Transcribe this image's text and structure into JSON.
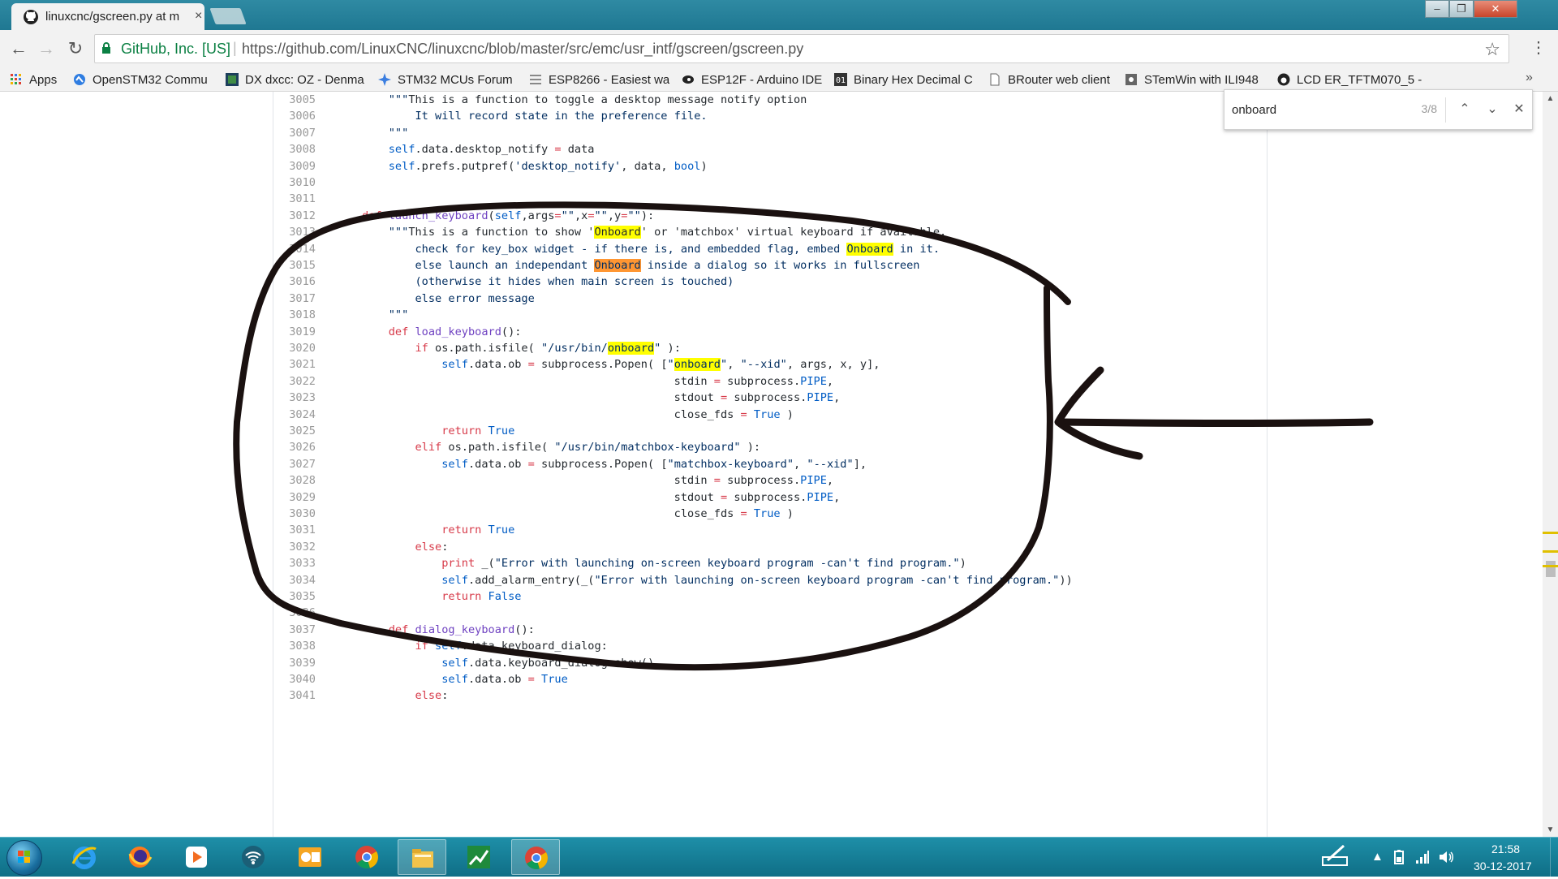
{
  "browser": {
    "tab_title": "linuxcnc/gscreen.py at m",
    "tab_close": "×",
    "window_controls": {
      "minimize": "–",
      "restore": "❐",
      "close": "✕"
    }
  },
  "toolbar": {
    "back": "←",
    "forward": "→",
    "reload": "↻",
    "ev_label": "GitHub, Inc. [US]",
    "separator": "|",
    "url": "https://github.com/LinuxCNC/linuxcnc/blob/master/src/emc/usr_intf/gscreen/gscreen.py",
    "star": "☆",
    "menu": "⋮"
  },
  "bookmarks": {
    "items": [
      {
        "label": "Apps",
        "icon": "apps-grid-icon"
      },
      {
        "label": "OpenSTM32 Commu",
        "icon": "openstm32-icon"
      },
      {
        "label": "DX dxcc: OZ - Denma",
        "icon": "dx-icon"
      },
      {
        "label": "STM32 MCUs Forum",
        "icon": "st-star-icon"
      },
      {
        "label": "ESP8266 - Easiest wa",
        "icon": "instructables-icon"
      },
      {
        "label": "ESP12F - Arduino IDE",
        "icon": "eye-icon"
      },
      {
        "label": "Binary Hex Decimal C",
        "icon": "binary-icon"
      },
      {
        "label": "BRouter web client",
        "icon": "page-icon"
      },
      {
        "label": "STemWin with ILI948",
        "icon": "gear-page-icon"
      },
      {
        "label": "LCD ER_TFTM070_5 -",
        "icon": "github-icon"
      }
    ],
    "more": "»"
  },
  "find": {
    "query": "onboard",
    "count": "3/8",
    "prev": "⌃",
    "next": "⌄",
    "close": "✕"
  },
  "code": {
    "lines": [
      {
        "n": "3005",
        "t": "        \"\"\"This is a function to toggle a desktop message notify option"
      },
      {
        "n": "3006",
        "t": "            It will record state in the preference file."
      },
      {
        "n": "3007",
        "t": "        \"\"\""
      },
      {
        "n": "3008",
        "t": "        self.data.desktop_notify = data"
      },
      {
        "n": "3009",
        "t": "        self.prefs.putpref('desktop_notify', data, bool)"
      },
      {
        "n": "3010",
        "t": ""
      },
      {
        "n": "3011",
        "t": ""
      },
      {
        "n": "3012",
        "t": "    def launch_keyboard(self,args=\"\",x=\"\",y=\"\"):"
      },
      {
        "n": "3013",
        "t": "        \"\"\"This is a function to show 'Onboard' or 'matchbox' virtual keyboard if available."
      },
      {
        "n": "3014",
        "t": "            check for key_box widget - if there is, and embedded flag, embed Onboard in it."
      },
      {
        "n": "3015",
        "t": "            else launch an independant Onboard inside a dialog so it works in fullscreen"
      },
      {
        "n": "3016",
        "t": "            (otherwise it hides when main screen is touched)"
      },
      {
        "n": "3017",
        "t": "            else error message"
      },
      {
        "n": "3018",
        "t": "        \"\"\""
      },
      {
        "n": "3019",
        "t": "        def load_keyboard():"
      },
      {
        "n": "3020",
        "t": "            if os.path.isfile( \"/usr/bin/onboard\" ):"
      },
      {
        "n": "3021",
        "t": "                self.data.ob = subprocess.Popen( [\"onboard\", \"--xid\", args, x, y],"
      },
      {
        "n": "3022",
        "t": "                                                   stdin = subprocess.PIPE,"
      },
      {
        "n": "3023",
        "t": "                                                   stdout = subprocess.PIPE,"
      },
      {
        "n": "3024",
        "t": "                                                   close_fds = True )"
      },
      {
        "n": "3025",
        "t": "                return True"
      },
      {
        "n": "3026",
        "t": "            elif os.path.isfile( \"/usr/bin/matchbox-keyboard\" ):"
      },
      {
        "n": "3027",
        "t": "                self.data.ob = subprocess.Popen( [\"matchbox-keyboard\", \"--xid\"],"
      },
      {
        "n": "3028",
        "t": "                                                   stdin = subprocess.PIPE,"
      },
      {
        "n": "3029",
        "t": "                                                   stdout = subprocess.PIPE,"
      },
      {
        "n": "3030",
        "t": "                                                   close_fds = True )"
      },
      {
        "n": "3031",
        "t": "                return True"
      },
      {
        "n": "3032",
        "t": "            else:"
      },
      {
        "n": "3033",
        "t": "                print _(\"Error with launching on-screen keyboard program -can't find program.\")"
      },
      {
        "n": "3034",
        "t": "                self.add_alarm_entry(_(\"Error with launching on-screen keyboard program -can't find program.\"))"
      },
      {
        "n": "3035",
        "t": "                return False"
      },
      {
        "n": "3036",
        "t": ""
      },
      {
        "n": "3037",
        "t": "        def dialog_keyboard():"
      },
      {
        "n": "3038",
        "t": "            if self.data.keyboard_dialog:"
      },
      {
        "n": "3039",
        "t": "                self.data.keyboard_dialog.show()"
      },
      {
        "n": "3040",
        "t": "                self.data.ob = True"
      },
      {
        "n": "3041",
        "t": "            else:"
      }
    ],
    "keywords": [
      "def",
      "if",
      "elif",
      "else",
      "return",
      "print"
    ],
    "constants": [
      "self",
      "True",
      "False",
      "bool",
      "PIPE"
    ],
    "highlight_term": "onboard",
    "current_match_index": 2
  },
  "scrollbar": {
    "up": "▲",
    "down": "▼",
    "position_fraction": 0.63,
    "match_marker_fractions": [
      0.59,
      0.615,
      0.635
    ]
  },
  "taskbar": {
    "apps": [
      {
        "name": "internet-explorer-icon",
        "active": false
      },
      {
        "name": "firefox-icon",
        "active": false
      },
      {
        "name": "media-player-icon",
        "active": false
      },
      {
        "name": "wifi-manager-icon",
        "active": false
      },
      {
        "name": "outlook-icon",
        "active": false
      },
      {
        "name": "chrome-icon",
        "active": false
      },
      {
        "name": "file-explorer-icon",
        "active": true
      },
      {
        "name": "stock-chart-icon",
        "active": false
      },
      {
        "name": "chrome-active-icon",
        "active": true
      }
    ],
    "time": "21:58",
    "date": "30-12-2017",
    "tray_arrow": "▲"
  },
  "colors": {
    "keyword": "#d73a49",
    "function": "#6f42c1",
    "string": "#032f62",
    "constant": "#005cc5",
    "match": "#ffff00",
    "current_match": "#ff9632",
    "annotation_ink": "#1a1110",
    "taskbar": "#1e8fa8"
  }
}
